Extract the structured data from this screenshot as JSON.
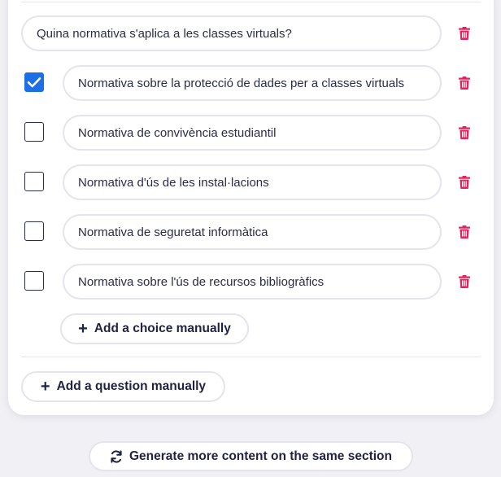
{
  "question": {
    "text": "Quina normativa s'aplica a les classes virtuals?"
  },
  "choices": [
    {
      "label": "Normativa sobre la protecció de dades per a classes virtuals",
      "checked": true
    },
    {
      "label": "Normativa de convivència estudiantil",
      "checked": false
    },
    {
      "label": "Normativa d'ús de les instal·lacions",
      "checked": false
    },
    {
      "label": "Normativa de seguretat informàtica",
      "checked": false
    },
    {
      "label": "Normativa sobre l'ús de recursos bibliogràfics",
      "checked": false
    }
  ],
  "actions": {
    "add_choice_label": "Add a choice manually",
    "add_question_label": "Add a question manually",
    "generate_label": "Generate more content on the same section",
    "plus_icon": "+"
  },
  "icons": {
    "delete": "trash-icon",
    "check": "check-icon",
    "refresh": "refresh-icon"
  },
  "colors": {
    "trash": "#e0245e",
    "checkbox_checked": "#1d6fe5",
    "text": "#1f2340",
    "border": "#e4e4ec"
  }
}
